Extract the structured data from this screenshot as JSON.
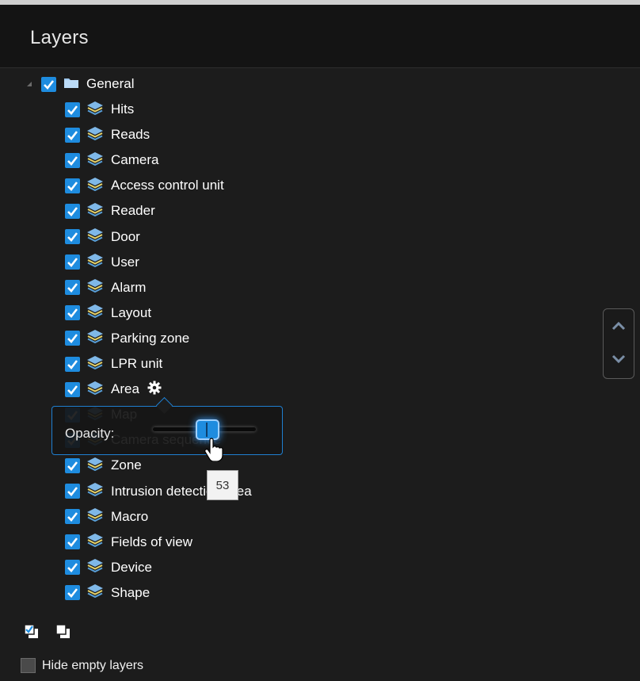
{
  "panel": {
    "title": "Layers"
  },
  "tree": {
    "root": {
      "label": "General",
      "checked": true
    },
    "items": [
      {
        "label": "Hits",
        "checked": true
      },
      {
        "label": "Reads",
        "checked": true
      },
      {
        "label": "Camera",
        "checked": true
      },
      {
        "label": "Access control unit",
        "checked": true
      },
      {
        "label": "Reader",
        "checked": true
      },
      {
        "label": "Door",
        "checked": true
      },
      {
        "label": "User",
        "checked": true
      },
      {
        "label": "Alarm",
        "checked": true
      },
      {
        "label": "Layout",
        "checked": true
      },
      {
        "label": "Parking zone",
        "checked": true
      },
      {
        "label": "LPR unit",
        "checked": true
      },
      {
        "label": "Area",
        "checked": true
      },
      {
        "label": "Map",
        "checked": true
      },
      {
        "label": "Camera sequence",
        "checked": true
      },
      {
        "label": "Zone",
        "checked": true
      },
      {
        "label": "Intrusion detection area",
        "checked": true
      },
      {
        "label": "Macro",
        "checked": true
      },
      {
        "label": "Fields of view",
        "checked": true
      },
      {
        "label": "Device",
        "checked": true
      },
      {
        "label": "Shape",
        "checked": true
      }
    ]
  },
  "opacity_popup": {
    "label": "Opacity:",
    "value": 53
  },
  "footer": {
    "hide_empty_label": "Hide empty layers",
    "hide_empty_checked": false
  },
  "icons": {
    "expander": "expanded-triangle-icon",
    "folder": "folder-icon",
    "layer": "layers-icon",
    "gear": "gear-icon",
    "check_all": "check-all-icon",
    "uncheck_all": "uncheck-all-icon",
    "scroll_up": "chevron-up-icon",
    "scroll_down": "chevron-down-icon",
    "cursor": "hand-cursor-icon"
  },
  "colors": {
    "accent": "#1e8cdf",
    "background": "#1c1c1c",
    "header": "#141414"
  }
}
